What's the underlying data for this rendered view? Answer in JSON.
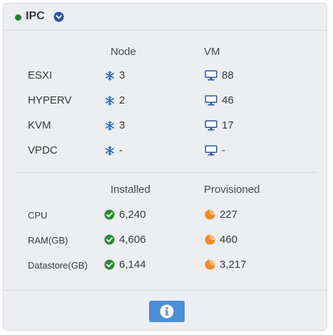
{
  "header": {
    "title": "IPC",
    "status_color": "#2e7d32",
    "status_icon": "green-status-dot",
    "expand_icon": "chevron-down-circle"
  },
  "hypervisors": {
    "headers": {
      "node": "Node",
      "vm": "VM"
    },
    "node_icon": "snowflake-node-icon",
    "vm_icon": "monitor-icon",
    "rows": [
      {
        "label": "ESXI",
        "node": "3",
        "vm": "88"
      },
      {
        "label": "HYPERV",
        "node": "2",
        "vm": "46"
      },
      {
        "label": "KVM",
        "node": "3",
        "vm": "17"
      },
      {
        "label": "VPDC",
        "node": "-",
        "vm": "-"
      }
    ]
  },
  "resources": {
    "headers": {
      "installed": "Installed",
      "provisioned": "Provisioned"
    },
    "installed_icon": "check-circle-icon",
    "provisioned_icon": "pie-chart-icon",
    "installed_color": "#2e8b3a",
    "provisioned_color": "#f08a24",
    "rows": [
      {
        "label": "CPU",
        "installed": "6,240",
        "provisioned": "227"
      },
      {
        "label": "RAM(GB)",
        "installed": "4,606",
        "provisioned": "460"
      },
      {
        "label": "Datastore(GB)",
        "installed": "6,144",
        "provisioned": "3,217"
      }
    ]
  },
  "footer": {
    "info_icon": "info-icon",
    "button_color": "#4a8fd6"
  }
}
